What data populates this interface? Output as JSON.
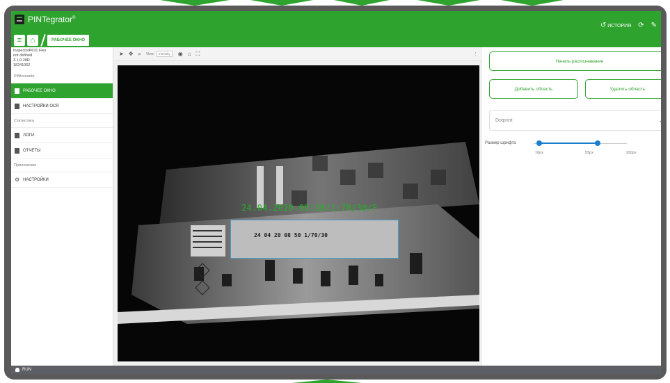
{
  "app": {
    "title": "PINTegrator",
    "trademark": "®"
  },
  "nav": {
    "menu_icon": "hamburger-icon",
    "home_icon": "home-icon",
    "breadcrumb": "РАБОЧЕЕ ОКНО"
  },
  "header_actions": {
    "history_label": "ИСТОРИЯ",
    "history_icon": "history-icon",
    "refresh_icon": "refresh-icon",
    "edit_icon": "pencil-icon"
  },
  "device": {
    "model": "InspectorP631 Flex",
    "line2": "not defined",
    "version": "3.1.0.28R",
    "serial": "18241062"
  },
  "sidebar": {
    "sections": [
      {
        "title": "PINtoreader",
        "items": [
          {
            "label": "РАБОЧЕЕ ОКНО",
            "active": true
          },
          {
            "label": "НАСТРОЙКИ OCR",
            "active": false
          }
        ]
      },
      {
        "title": "Статистика",
        "items": [
          {
            "label": "ЛОГИ"
          },
          {
            "label": "ОТЧЕТЫ"
          }
        ]
      },
      {
        "title": "Приложение",
        "items": [
          {
            "label": "НАСТРОЙКИ"
          }
        ]
      }
    ]
  },
  "viewer": {
    "view_label": "View:",
    "view_value": "Intensity",
    "tools": [
      "pointer-icon",
      "move-icon",
      "zoom-icon",
      "palette-icon",
      "home-icon",
      "fit-icon"
    ],
    "ocr_result": "24.04.2020.08:50/1:70/30/F",
    "stamp_text": "24 04 20 08 50 1/70/30"
  },
  "panel": {
    "start_button": "Начать распознавание",
    "add_area_button": "Добавить область",
    "remove_area_button": "Удалить область",
    "font_select": "Dotprint",
    "font_size_label": "Размер шрифта",
    "font_size_ticks": [
      "10px",
      "55px",
      "100px"
    ],
    "font_size_min": 10,
    "font_size_max": 100,
    "font_size_range": [
      15,
      55
    ]
  },
  "status": {
    "label": "RUN"
  },
  "colors": {
    "accent": "#2ea32e",
    "slider": "#1a7fd0",
    "roi": "#4aa0c8",
    "statusbar": "#5c5f63"
  }
}
